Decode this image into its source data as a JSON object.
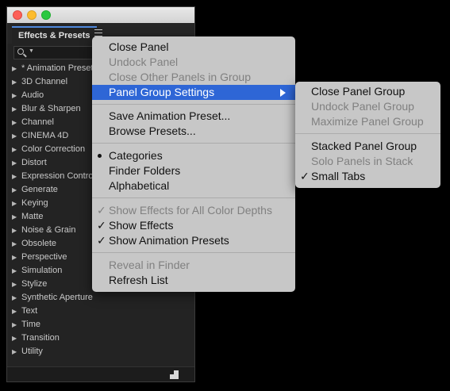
{
  "panel": {
    "tab_label": "Effects & Presets",
    "categories": [
      "* Animation Presets",
      "3D Channel",
      "Audio",
      "Blur & Sharpen",
      "Channel",
      "CINEMA 4D",
      "Color Correction",
      "Distort",
      "Expression Controls",
      "Generate",
      "Keying",
      "Matte",
      "Noise & Grain",
      "Obsolete",
      "Perspective",
      "Simulation",
      "Stylize",
      "Synthetic Aperture",
      "Text",
      "Time",
      "Transition",
      "Utility"
    ]
  },
  "menu": {
    "close_panel": "Close Panel",
    "undock_panel": "Undock Panel",
    "close_other_panels": "Close Other Panels in Group",
    "panel_group_settings": "Panel Group Settings",
    "save_animation_preset": "Save Animation Preset...",
    "browse_presets": "Browse Presets...",
    "categories": "Categories",
    "finder_folders": "Finder Folders",
    "alphabetical": "Alphabetical",
    "show_effects_all_depths": "Show Effects for All Color Depths",
    "show_effects": "Show Effects",
    "show_animation_presets": "Show Animation Presets",
    "reveal_in_finder": "Reveal in Finder",
    "refresh_list": "Refresh List"
  },
  "submenu": {
    "close_panel_group": "Close Panel Group",
    "undock_panel_group": "Undock Panel Group",
    "maximize_panel_group": "Maximize Panel Group",
    "stacked_panel_group": "Stacked Panel Group",
    "solo_panels_in_stack": "Solo Panels in Stack",
    "small_tabs": "Small Tabs"
  },
  "marks": {
    "check": "✓",
    "arrow": "▶"
  },
  "colors": {
    "highlight": "#2e66d6",
    "tab_accent": "#4f88dc",
    "menu_bg": "#c7c7c7",
    "panel_bg": "#232323"
  }
}
